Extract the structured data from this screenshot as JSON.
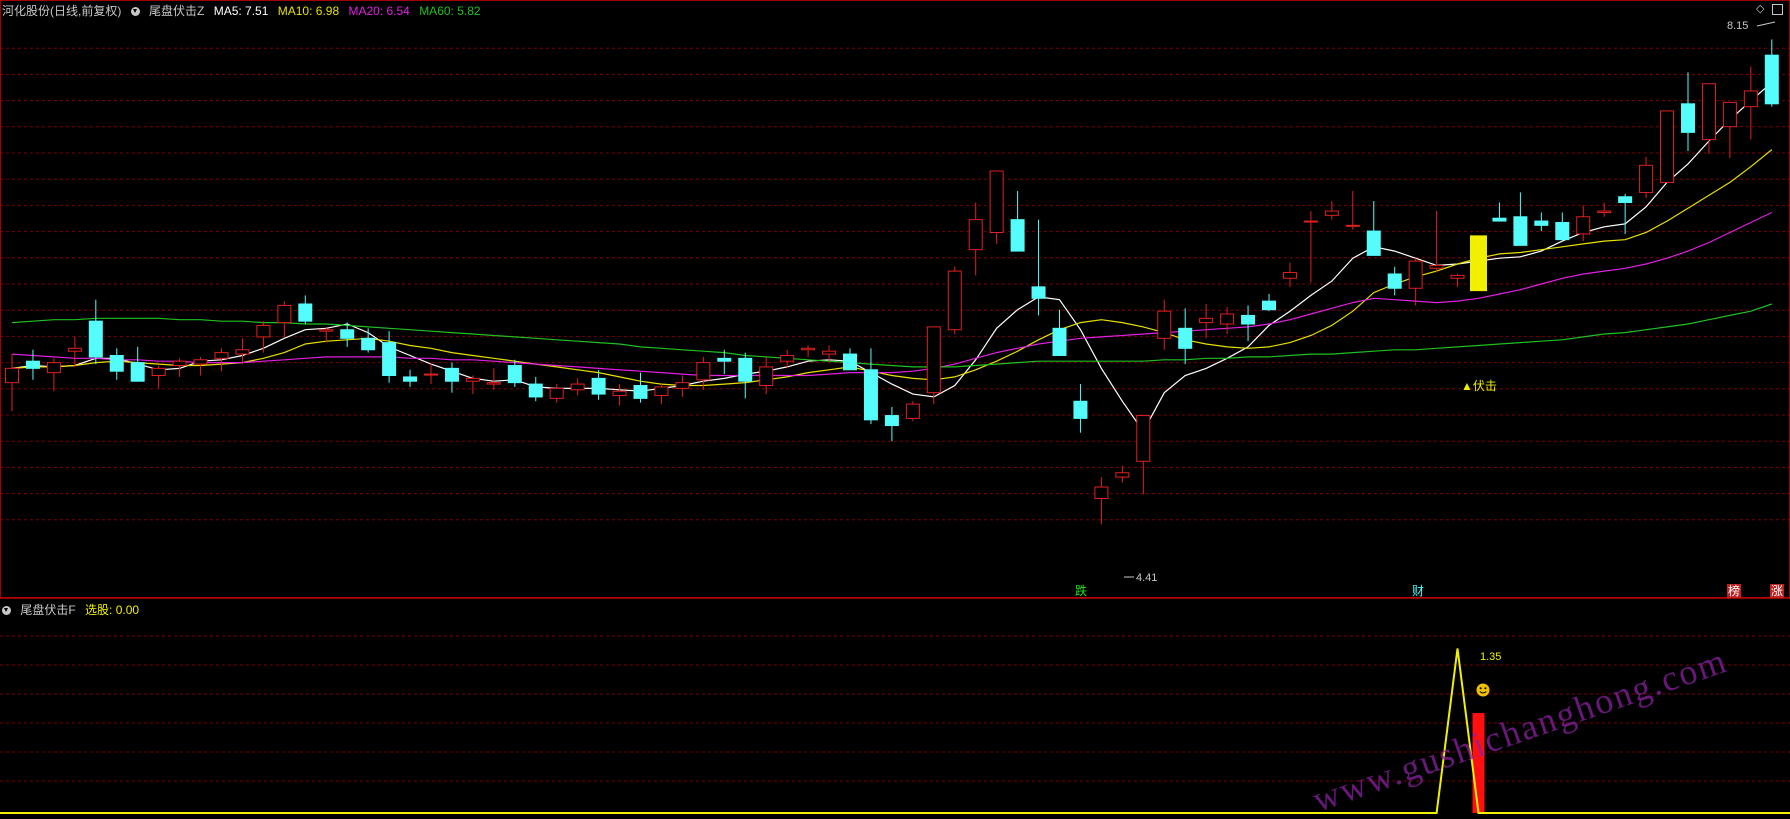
{
  "header": {
    "stock_title": "河化股份(日线,前复权)",
    "indicator_main": "尾盘伏击Z",
    "ma5": "MA5: 7.51",
    "ma10": "MA10: 6.98",
    "ma20": "MA20: 6.54",
    "ma60": "MA60: 5.82"
  },
  "sub_header": {
    "indicator_sub": "尾盘伏击F",
    "xuan_gu": "选股: 0.00"
  },
  "annotations": {
    "high_label": "8.15",
    "low_label": "4.41",
    "signal_label": "▲伏击",
    "peak_label": "1.35",
    "marker_die": "跌",
    "marker_cai": "财",
    "marker_bang": "榜",
    "marker_zhang": "涨",
    "watermark": "www.gushichanghong.com"
  },
  "colors": {
    "up": "#e02020",
    "down": "#54fcfc",
    "ma5": "#ffffff",
    "ma10": "#e8e000",
    "ma20": "#e020e0",
    "ma60": "#20c020",
    "grid": "#7a0000",
    "signal": "#f0f000"
  },
  "icons": [
    "settings-circle-icon",
    "diamond-icon",
    "window-icon",
    "smiley-icon"
  ],
  "chart_data": [
    {
      "type": "candlestick",
      "title": "河化股份(日线,前复权)",
      "ylim": [
        4.3,
        8.3
      ],
      "series": [
        {
          "name": "K",
          "ohlc": [
            [
              5.75,
              5.95,
              5.55,
              5.85
            ],
            [
              5.9,
              5.98,
              5.77,
              5.85
            ],
            [
              5.82,
              5.92,
              5.69,
              5.89
            ],
            [
              5.97,
              6.07,
              5.86,
              5.99
            ],
            [
              6.18,
              6.33,
              5.88,
              5.93
            ],
            [
              5.94,
              5.99,
              5.77,
              5.83
            ],
            [
              5.89,
              6.0,
              5.76,
              5.76
            ],
            [
              5.8,
              5.87,
              5.71,
              5.85
            ],
            [
              5.87,
              5.92,
              5.79,
              5.9
            ],
            [
              5.88,
              5.93,
              5.8,
              5.91
            ],
            [
              5.92,
              5.99,
              5.83,
              5.96
            ],
            [
              5.95,
              6.06,
              5.88,
              5.98
            ],
            [
              6.07,
              6.18,
              5.96,
              6.15
            ],
            [
              6.17,
              6.32,
              6.07,
              6.29
            ],
            [
              6.3,
              6.36,
              6.16,
              6.18
            ],
            [
              6.11,
              6.14,
              6.03,
              6.12
            ],
            [
              6.12,
              6.17,
              6.0,
              6.06
            ],
            [
              6.06,
              6.13,
              5.96,
              5.98
            ],
            [
              6.03,
              6.11,
              5.75,
              5.8
            ],
            [
              5.79,
              5.84,
              5.72,
              5.76
            ],
            [
              5.81,
              5.89,
              5.74,
              5.81
            ],
            [
              5.85,
              5.89,
              5.68,
              5.76
            ],
            [
              5.76,
              5.8,
              5.67,
              5.78
            ],
            [
              5.74,
              5.85,
              5.7,
              5.75
            ],
            [
              5.87,
              5.91,
              5.72,
              5.75
            ],
            [
              5.74,
              5.79,
              5.62,
              5.65
            ],
            [
              5.64,
              5.74,
              5.61,
              5.71
            ],
            [
              5.7,
              5.78,
              5.66,
              5.74
            ],
            [
              5.78,
              5.84,
              5.63,
              5.67
            ],
            [
              5.66,
              5.74,
              5.59,
              5.69
            ],
            [
              5.73,
              5.82,
              5.61,
              5.64
            ],
            [
              5.66,
              5.74,
              5.6,
              5.72
            ],
            [
              5.71,
              5.8,
              5.65,
              5.75
            ],
            [
              5.77,
              5.93,
              5.7,
              5.89
            ],
            [
              5.92,
              5.98,
              5.81,
              5.9
            ],
            [
              5.92,
              5.96,
              5.64,
              5.76
            ],
            [
              5.73,
              5.93,
              5.67,
              5.86
            ],
            [
              5.9,
              5.98,
              5.85,
              5.94
            ],
            [
              5.98,
              6.01,
              5.93,
              5.99
            ],
            [
              5.95,
              6.01,
              5.9,
              5.97
            ],
            [
              5.95,
              5.99,
              5.84,
              5.84
            ],
            [
              5.84,
              5.99,
              5.46,
              5.49
            ],
            [
              5.52,
              5.58,
              5.34,
              5.45
            ],
            [
              5.5,
              5.62,
              5.48,
              5.6
            ],
            [
              5.68,
              6.08,
              5.6,
              6.14
            ],
            [
              6.12,
              6.56,
              6.09,
              6.53
            ],
            [
              6.68,
              7.01,
              6.5,
              6.89
            ],
            [
              6.8,
              7.23,
              6.72,
              7.23
            ],
            [
              6.89,
              7.09,
              6.67,
              6.67
            ],
            [
              6.42,
              6.89,
              6.22,
              6.34
            ],
            [
              6.13,
              6.26,
              5.94,
              5.94
            ],
            [
              5.62,
              5.74,
              5.4,
              5.5
            ],
            [
              4.94,
              5.09,
              4.76,
              5.02
            ],
            [
              5.09,
              5.17,
              5.05,
              5.12
            ],
            [
              5.2,
              5.52,
              4.97,
              5.52
            ],
            [
              6.06,
              6.33,
              5.98,
              6.25
            ],
            [
              6.13,
              6.27,
              5.88,
              5.99
            ],
            [
              6.17,
              6.3,
              6.06,
              6.2
            ],
            [
              6.16,
              6.28,
              6.09,
              6.23
            ],
            [
              6.22,
              6.29,
              6.04,
              6.16
            ],
            [
              6.32,
              6.37,
              6.25,
              6.26
            ],
            [
              6.48,
              6.59,
              6.42,
              6.52
            ],
            [
              6.88,
              6.95,
              6.45,
              6.88
            ],
            [
              6.92,
              7.02,
              6.89,
              6.95
            ],
            [
              6.85,
              7.09,
              6.82,
              6.85
            ],
            [
              6.81,
              7.02,
              6.71,
              6.64
            ],
            [
              6.51,
              6.56,
              6.36,
              6.41
            ],
            [
              6.41,
              6.62,
              6.29,
              6.6
            ],
            [
              6.55,
              6.95,
              6.52,
              6.57
            ],
            [
              6.48,
              6.51,
              6.42,
              6.5
            ],
            [
              6.51,
              6.59,
              6.4,
              6.66
            ],
            [
              6.9,
              7.01,
              6.89,
              6.88
            ],
            [
              6.91,
              7.08,
              6.79,
              6.71
            ],
            [
              6.88,
              6.94,
              6.81,
              6.85
            ],
            [
              6.87,
              6.94,
              6.78,
              6.75
            ],
            [
              6.79,
              6.99,
              6.74,
              6.91
            ],
            [
              6.94,
              7.01,
              6.91,
              6.95
            ],
            [
              7.05,
              7.07,
              6.79,
              7.01
            ],
            [
              7.08,
              7.33,
              7.04,
              7.27
            ],
            [
              7.15,
              7.65,
              7.15,
              7.65
            ],
            [
              7.7,
              7.92,
              7.37,
              7.5
            ],
            [
              7.45,
              7.68,
              7.35,
              7.84
            ],
            [
              7.54,
              7.66,
              7.32,
              7.71
            ],
            [
              7.68,
              7.96,
              7.45,
              7.79
            ],
            [
              8.04,
              8.15,
              7.68,
              7.7
            ]
          ]
        },
        {
          "name": "MA5",
          "values": [
            5.85,
            5.87,
            5.86,
            5.87,
            5.92,
            5.92,
            5.88,
            5.84,
            5.85,
            5.9,
            5.91,
            5.94,
            5.99,
            6.06,
            6.12,
            6.13,
            6.16,
            6.1,
            6.0,
            5.94,
            5.88,
            5.83,
            5.78,
            5.76,
            5.77,
            5.72,
            5.71,
            5.71,
            5.71,
            5.7,
            5.69,
            5.71,
            5.73,
            5.76,
            5.78,
            5.81,
            5.83,
            5.86,
            5.9,
            5.91,
            5.9,
            5.82,
            5.74,
            5.67,
            5.65,
            5.73,
            5.91,
            6.13,
            6.26,
            6.35,
            6.33,
            6.12,
            5.85,
            5.62,
            5.41,
            5.68,
            5.8,
            5.85,
            5.92,
            6.0,
            6.15,
            6.25,
            6.36,
            6.46,
            6.62,
            6.7,
            6.67,
            6.62,
            6.57,
            6.58,
            6.6,
            6.62,
            6.63,
            6.67,
            6.74,
            6.8,
            6.84,
            6.86,
            6.98,
            7.15,
            7.28,
            7.44,
            7.59,
            7.72,
            7.85
          ]
        },
        {
          "name": "MA10",
          "values": [
            5.85,
            5.86,
            5.86,
            5.87,
            5.89,
            5.9,
            5.89,
            5.88,
            5.87,
            5.87,
            5.88,
            5.89,
            5.92,
            5.96,
            6.02,
            6.04,
            6.05,
            6.06,
            6.04,
            6.01,
            5.99,
            5.96,
            5.94,
            5.92,
            5.9,
            5.88,
            5.86,
            5.84,
            5.82,
            5.79,
            5.76,
            5.74,
            5.73,
            5.73,
            5.74,
            5.75,
            5.77,
            5.79,
            5.82,
            5.84,
            5.86,
            5.83,
            5.8,
            5.78,
            5.77,
            5.79,
            5.84,
            5.9,
            5.97,
            6.05,
            6.12,
            6.17,
            6.19,
            6.17,
            6.14,
            6.1,
            6.05,
            6.02,
            6.0,
            5.99,
            6.0,
            6.03,
            6.08,
            6.15,
            6.25,
            6.38,
            6.44,
            6.49,
            6.53,
            6.58,
            6.62,
            6.65,
            6.66,
            6.68,
            6.7,
            6.72,
            6.74,
            6.75,
            6.8,
            6.88,
            6.97,
            7.06,
            7.15,
            7.26,
            7.38
          ]
        },
        {
          "name": "MA20",
          "values": [
            5.95,
            5.94,
            5.93,
            5.92,
            5.92,
            5.91,
            5.91,
            5.9,
            5.9,
            5.89,
            5.89,
            5.89,
            5.9,
            5.91,
            5.92,
            5.93,
            5.93,
            5.93,
            5.93,
            5.92,
            5.92,
            5.91,
            5.91,
            5.9,
            5.89,
            5.88,
            5.87,
            5.86,
            5.85,
            5.84,
            5.83,
            5.82,
            5.81,
            5.8,
            5.8,
            5.8,
            5.8,
            5.8,
            5.8,
            5.81,
            5.82,
            5.82,
            5.82,
            5.83,
            5.85,
            5.88,
            5.92,
            5.96,
            5.99,
            6.02,
            6.04,
            6.06,
            6.07,
            6.08,
            6.09,
            6.1,
            6.11,
            6.12,
            6.13,
            6.14,
            6.16,
            6.19,
            6.23,
            6.27,
            6.31,
            6.34,
            6.33,
            6.32,
            6.31,
            6.32,
            6.34,
            6.37,
            6.4,
            6.44,
            6.48,
            6.51,
            6.53,
            6.55,
            6.58,
            6.62,
            6.67,
            6.73,
            6.8,
            6.87,
            6.94
          ]
        },
        {
          "name": "MA60",
          "values": [
            6.17,
            6.18,
            6.19,
            6.19,
            6.2,
            6.2,
            6.2,
            6.2,
            6.19,
            6.19,
            6.18,
            6.18,
            6.17,
            6.17,
            6.16,
            6.16,
            6.15,
            6.14,
            6.13,
            6.12,
            6.11,
            6.1,
            6.09,
            6.08,
            6.07,
            6.06,
            6.05,
            6.04,
            6.03,
            6.02,
            6.0,
            5.99,
            5.98,
            5.97,
            5.96,
            5.94,
            5.93,
            5.92,
            5.91,
            5.9,
            5.89,
            5.88,
            5.87,
            5.86,
            5.86,
            5.86,
            5.87,
            5.88,
            5.89,
            5.9,
            5.9,
            5.9,
            5.9,
            5.9,
            5.9,
            5.91,
            5.91,
            5.92,
            5.92,
            5.93,
            5.93,
            5.94,
            5.95,
            5.95,
            5.96,
            5.97,
            5.98,
            5.98,
            5.99,
            6.0,
            6.01,
            6.02,
            6.03,
            6.04,
            6.05,
            6.07,
            6.09,
            6.1,
            6.12,
            6.14,
            6.16,
            6.19,
            6.22,
            6.25,
            6.3
          ]
        }
      ]
    },
    {
      "type": "line",
      "title": "尾盘伏击F",
      "ylim": [
        0,
        1.6
      ],
      "series": [
        {
          "name": "选股",
          "values": [
            0,
            0,
            0,
            0,
            0,
            0,
            0,
            0,
            0,
            0,
            0,
            0,
            0,
            0,
            0,
            0,
            0,
            0,
            0,
            0,
            0,
            0,
            0,
            0,
            0,
            0,
            0,
            0,
            0,
            0,
            0,
            0,
            0,
            0,
            0,
            0,
            0,
            0,
            0,
            0,
            0,
            0,
            0,
            0,
            0,
            0,
            0,
            0,
            0,
            0,
            0,
            0,
            0,
            0,
            0,
            0,
            0,
            0,
            0,
            0,
            0,
            0,
            0,
            0,
            0,
            0,
            0,
            0,
            0,
            1.35,
            0,
            0,
            0,
            0,
            0,
            0,
            0,
            0,
            0,
            0,
            0,
            0,
            0,
            0,
            0
          ]
        }
      ],
      "bar_signal": {
        "index": 70,
        "value": 0.82
      }
    }
  ]
}
